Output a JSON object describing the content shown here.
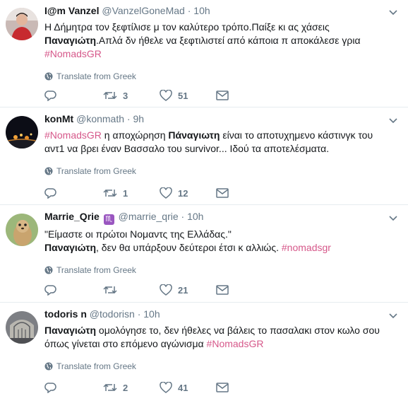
{
  "translate_label": "Translate from Greek",
  "tweets": [
    {
      "display_name": "I@m Vanzel",
      "screen_name": "@VanzelGoneMad",
      "timestamp": "10h",
      "lines": [
        [
          "Η Δήμητρα τον ξεφτίλισε μ τον καλύτερο τρόπο.Παίξε κι ας χάσεις"
        ],
        [
          "Παναγιώτη",
          ".Απλά δν ήθελε να ξεφτιλιστεί από κάποια π αποκάλεσε γρια"
        ],
        [
          "#NomadsGR"
        ]
      ],
      "replies": "",
      "retweets": "3",
      "likes": "51"
    },
    {
      "display_name": "konMt",
      "screen_name": "@konmath",
      "timestamp": "9h",
      "lines": [
        [
          "#NomadsGR",
          " η αποχώρηση ",
          "Πάναγιωτη",
          " είναι το αποτυχημενο κάστινγκ του"
        ],
        [
          "αντ1 να βρει έναν Βασσαλο του survivor... Ιδού τα αποτελέσματα."
        ]
      ],
      "replies": "",
      "retweets": "1",
      "likes": "12"
    },
    {
      "display_name": "Marrie_Qrie",
      "badge": "♏",
      "screen_name": "@marrie_qrie",
      "timestamp": "10h",
      "lines": [
        [
          "\"Είμαστε οι πρώτοι Νομαντς της Ελλάδας.\""
        ],
        [
          "Παναγιώτη",
          ", δεν θα υπάρξουν δεύτεροι έτσι κ αλλιώς.  ",
          "#nomadsgr"
        ]
      ],
      "replies": "",
      "retweets": "",
      "likes": "21"
    },
    {
      "display_name": "todoris n",
      "screen_name": "@todorisn",
      "timestamp": "10h",
      "lines": [
        [
          "Παναγιώτη",
          " ομολόγησε το, δεν ήθελες να βάλεις το πασαλακι στον κωλο σου"
        ],
        [
          "όπως γίνεται στο επόμενο αγώνισμα  ",
          "#NomadsGR"
        ]
      ],
      "replies": "",
      "retweets": "2",
      "likes": "41"
    }
  ],
  "colors": {
    "hashtag": "#d6588a",
    "muted": "#657786",
    "text": "#14171a",
    "divider": "#e6ecf0"
  }
}
